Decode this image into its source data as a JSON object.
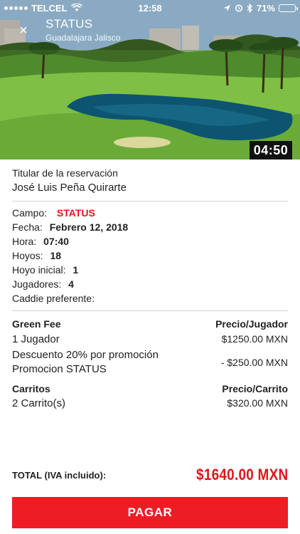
{
  "status_bar": {
    "carrier": "TELCEL",
    "time": "12:58",
    "battery_pct": "71%",
    "battery_level": 0.71,
    "icons": [
      "signal-dots-icon",
      "wifi-icon",
      "location-icon",
      "alarm-icon",
      "bluetooth-icon",
      "battery-icon"
    ]
  },
  "header": {
    "close_glyph": "×",
    "title": "STATUS",
    "subtitle": "Guadalajara Jalisco",
    "timer": "04:50"
  },
  "reservation": {
    "holder_label": "Titular de la reservación",
    "holder_name": "José Luis Peña  Quirarte"
  },
  "details": {
    "campo_label": "Campo:",
    "campo_value": "STATUS",
    "fecha_label": "Fecha:",
    "fecha_value": "Febrero 12, 2018",
    "hora_label": "Hora:",
    "hora_value": "07:40",
    "hoyos_label": "Hoyos:",
    "hoyos_value": "18",
    "hoyo_inicial_label": "Hoyo inicial:",
    "hoyo_inicial_value": "1",
    "jugadores_label": "Jugadores:",
    "jugadores_value": "4",
    "caddie_label": "Caddie preferente:"
  },
  "green_fee": {
    "title": "Green Fee",
    "price_header": "Precio/Jugador",
    "line1_label": "1 Jugador",
    "line1_value": "$1250.00 MXN",
    "discount_label_1": "Descuento 20% por promoción",
    "discount_label_2": "Promocion STATUS",
    "discount_value": "- $250.00 MXN"
  },
  "carritos": {
    "title": "Carritos",
    "price_header": "Precio/Carrito",
    "line_label": "2 Carrito(s)",
    "line_value": "$320.00 MXN"
  },
  "total": {
    "label": "TOTAL (IVA incluido):",
    "value": "$1640.00 MXN"
  },
  "pay_button": {
    "label": "PAGAR"
  },
  "colors": {
    "accent_red": "#e0141b",
    "button_red": "#ee1c25",
    "timer_bg": "#111111",
    "battery_yellow": "#ffd60a"
  }
}
